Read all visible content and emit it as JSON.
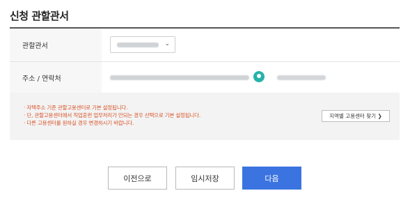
{
  "page": {
    "title": "신청 관할관서"
  },
  "form": {
    "jurisdiction_label": "관할관서",
    "jurisdiction_value": "",
    "address_label": "주소 / 연락처",
    "address_value": "",
    "phone_value": ""
  },
  "notice": {
    "items": [
      "자택주소 기준 관할고용센터로 기본 설정됩니다.",
      "단, 관할고용센터에서 직업훈련 업무처리가 안되는 경우 선택으로 기본 설정됩니다.",
      "다른 고용센터를 원하실 경우 변경하시기 바랍니다."
    ],
    "find_button": "지역별 고용센터 찾기 ❯"
  },
  "actions": {
    "prev": "이전으로",
    "temp_save": "임시저장",
    "next": "다음",
    "next_color": "#3b74e0"
  },
  "icons": {
    "select_chevron": "chevron-down-icon",
    "location": "location-pin-icon"
  }
}
